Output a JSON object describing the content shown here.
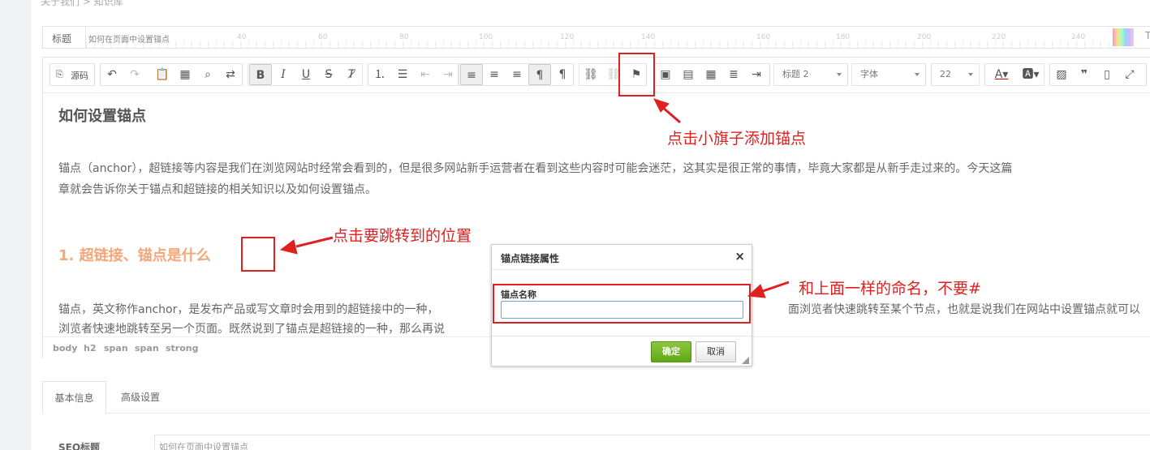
{
  "breadcrumb": "关于我们 > 知识库",
  "title_field": {
    "label": "标题",
    "value": "如何在页面中设置锚点",
    "ruler_marks": [
      "40",
      "60",
      "80",
      "100",
      "120",
      "140",
      "160",
      "180",
      "200",
      "220",
      "240"
    ],
    "right_mark": "T"
  },
  "toolbar": {
    "source_label": "源码",
    "heading_select": "标题 2",
    "font_select": "字体",
    "size_select": "22"
  },
  "content": {
    "h1": "如何设置锚点",
    "p1_line1": "锚点（anchor），超链接等内容是我们在浏览网站时经常会看到的，但是很多网站新手运营者在看到这些内容时可能会迷茫，这其实是很正常的事情，毕竟大家都是从新手走过来的。今天这篇",
    "p1_line2": "章就会告诉你关于锚点和超链接的相关知识以及如何设置锚点。",
    "h2": "1. 超链接、锚点是什么",
    "p2_line1": "锚点，英文称作anchor，是发布产品或写文章时会用到的超链接中的一种，",
    "p2_line1b": "面浏览者快速跳转至某个节点，也就是说我们在网站中设置锚点就可以",
    "p2_line2": "浏览者快速地跳转至另一个页面。既然说到了锚点是超链接的一种，那么再说"
  },
  "element_path": [
    "body",
    "h2",
    "span",
    "span",
    "strong"
  ],
  "tabs": [
    {
      "label": "基本信息",
      "active": true
    },
    {
      "label": "高级设置",
      "active": false
    }
  ],
  "seo": {
    "label": "SEO标题",
    "value": "如何在页面中设置锚点"
  },
  "dialog": {
    "title": "锚点链接属性",
    "close": "×",
    "field_label": "锚点名称",
    "field_value": "",
    "ok_label": "确定",
    "cancel_label": "取消"
  },
  "annotations": {
    "flag_note": "点击小旗子添加锚点",
    "position_note": "点击要跳转到的位置",
    "name_note": "和上面一样的命名，不要#",
    "color": "#e02020"
  },
  "colors": {
    "ok_button": "#6ab023",
    "heading2": "#f5a77a",
    "input_focus": "#6aa6d8"
  }
}
